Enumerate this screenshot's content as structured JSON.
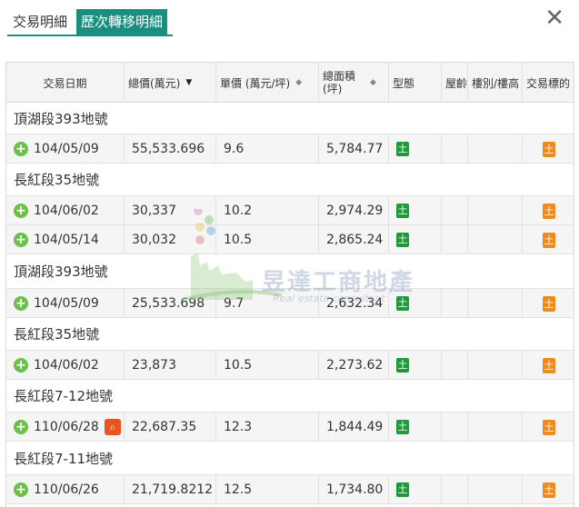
{
  "tabs": [
    {
      "label": "交易明細",
      "active": false
    },
    {
      "label": "歷次轉移明細",
      "active": true
    }
  ],
  "close_label": "✕",
  "columns": [
    {
      "label": "交易日期",
      "sortable": false
    },
    {
      "label": "總價(萬元)",
      "sortable": true,
      "active": true
    },
    {
      "label": "單價 (萬元/坪)",
      "sortable": true
    },
    {
      "label": "總面積 (坪)",
      "sortable": true
    },
    {
      "label": "型態",
      "sortable": false
    },
    {
      "label": "屋齡",
      "sortable": false
    },
    {
      "label": "樓別/樓高",
      "sortable": false
    },
    {
      "label": "交易標的",
      "sortable": false
    }
  ],
  "groups": [
    {
      "title": "頂湖段393地號",
      "rows": [
        {
          "date": "104/05/09",
          "total": "55,533.696",
          "unit": "9.6",
          "area": "5,784.77",
          "type_icon": "土",
          "target_icon": "土",
          "search": false
        }
      ]
    },
    {
      "title": "長紅段35地號",
      "rows": [
        {
          "date": "104/06/02",
          "total": "30,337",
          "unit": "10.2",
          "area": "2,974.29",
          "type_icon": "土",
          "target_icon": "土",
          "search": false
        },
        {
          "date": "104/05/14",
          "total": "30,032",
          "unit": "10.5",
          "area": "2,865.24",
          "type_icon": "土",
          "target_icon": "土",
          "search": false
        }
      ]
    },
    {
      "title": "頂湖段393地號",
      "rows": [
        {
          "date": "104/05/09",
          "total": "25,533.698",
          "unit": "9.7",
          "area": "2,632.34",
          "type_icon": "土",
          "target_icon": "土",
          "search": false
        }
      ]
    },
    {
      "title": "長紅段35地號",
      "rows": [
        {
          "date": "104/06/02",
          "total": "23,873",
          "unit": "10.5",
          "area": "2,273.62",
          "type_icon": "土",
          "target_icon": "土",
          "search": false
        }
      ]
    },
    {
      "title": "長紅段7-12地號",
      "rows": [
        {
          "date": "110/06/28",
          "total": "22,687.35",
          "unit": "12.3",
          "area": "1,844.49",
          "type_icon": "土",
          "target_icon": "土",
          "search": true
        }
      ]
    },
    {
      "title": "長紅段7-11地號",
      "rows": [
        {
          "date": "110/06/26",
          "total": "21,719.8212",
          "unit": "12.5",
          "area": "1,734.80",
          "type_icon": "土",
          "target_icon": "土",
          "search": false
        }
      ]
    }
  ],
  "watermark": {
    "title": "昱達工商地產",
    "subtitle": "Real estate consultant"
  },
  "colors": {
    "accent": "#1a8f80",
    "type_icon": "#1f9a3a",
    "target_icon": "#f08a1c",
    "plus": "#6bbf4a",
    "search_icon": "#e8541c"
  }
}
